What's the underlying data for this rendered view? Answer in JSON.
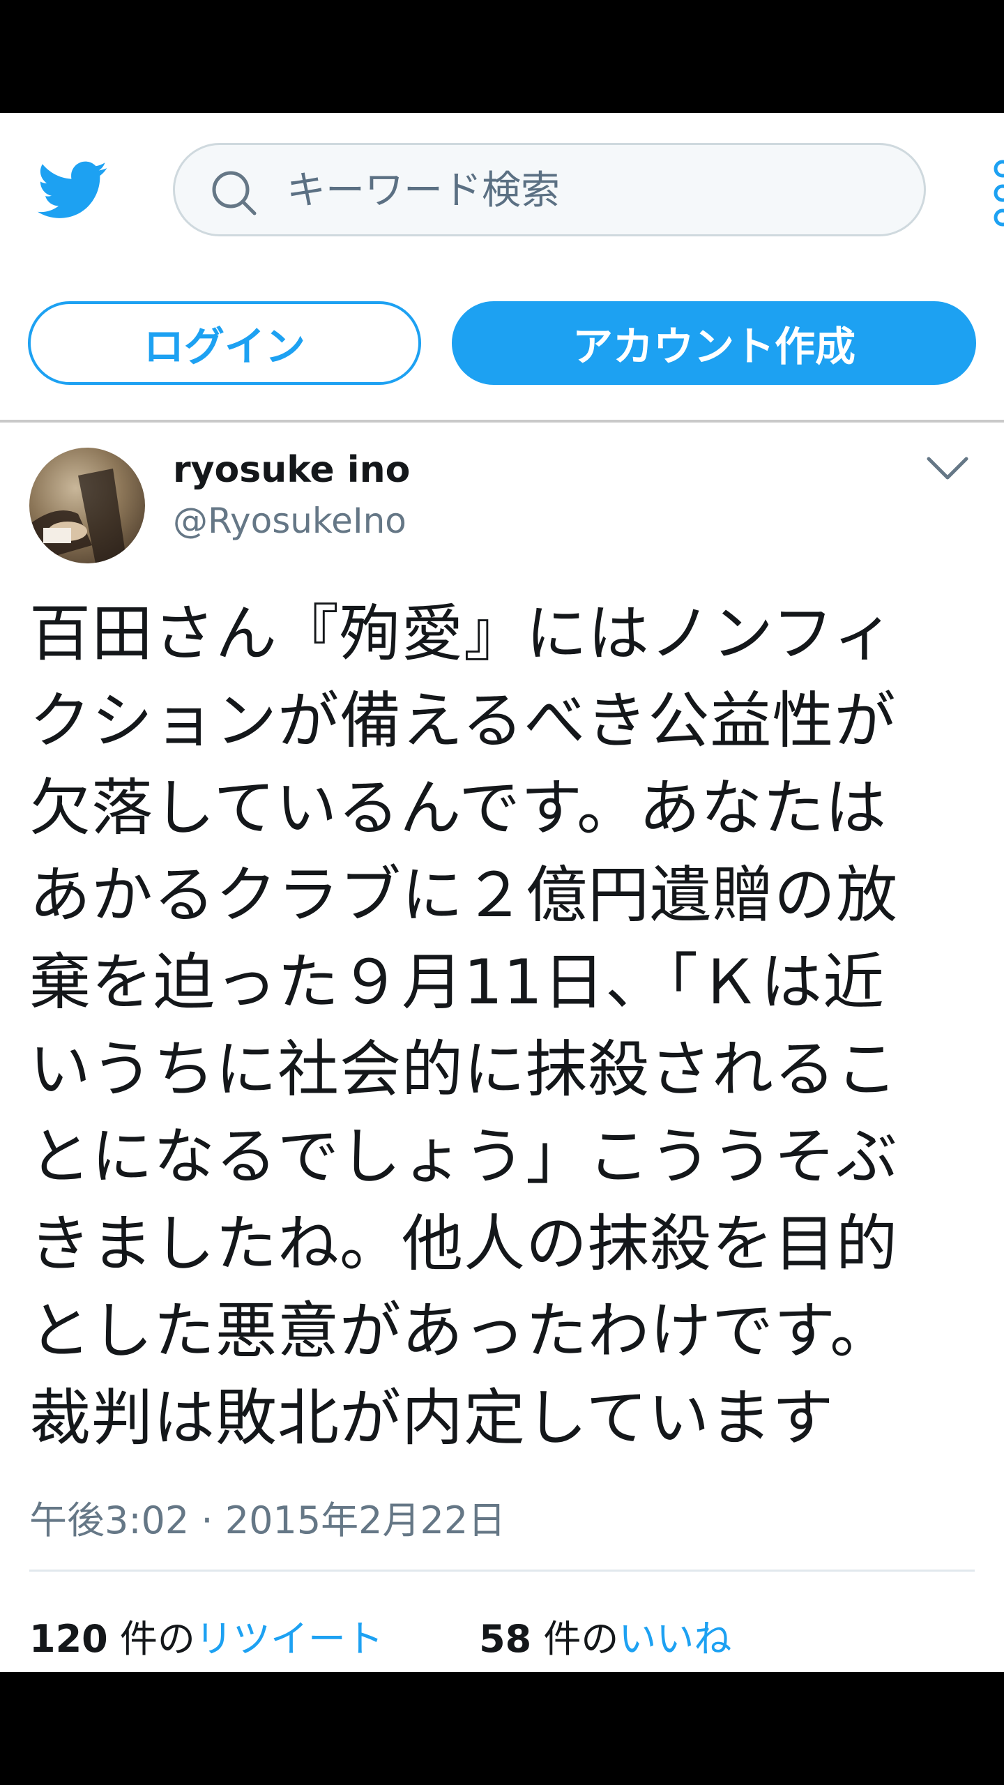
{
  "header": {
    "search_placeholder": "キーワード検索",
    "login_label": "ログイン",
    "signup_label": "アカウント作成"
  },
  "tweet": {
    "display_name": "ryosuke ino",
    "handle": "@RyosukeIno",
    "text": "百田さん『殉愛』にはノンフィ\nクションが備えるべき公益性が\n欠落しているんです。あなたは\nあかるクラブに２億円遺贈の放\n棄を迫った９月11日、「Ｋは近\nいうちに社会的に抹殺されるこ\nとになるでしょう」こううそぶ\nきましたね。他人の抹殺を目的\nとした悪意があったわけです。\n裁判は敗北が内定しています",
    "timestamp": "午後3:02 · 2015年2月22日",
    "retweets": {
      "count": "120",
      "unit": "件の",
      "label": "リツイート"
    },
    "likes": {
      "count": "58",
      "unit": "件の",
      "label": "いいね"
    }
  },
  "colors": {
    "accent": "#1da1f2",
    "text": "#14171a",
    "secondary": "#657786"
  },
  "icons": [
    "twitter-bird-icon",
    "search-icon",
    "more-icon",
    "chevron-down-icon"
  ]
}
